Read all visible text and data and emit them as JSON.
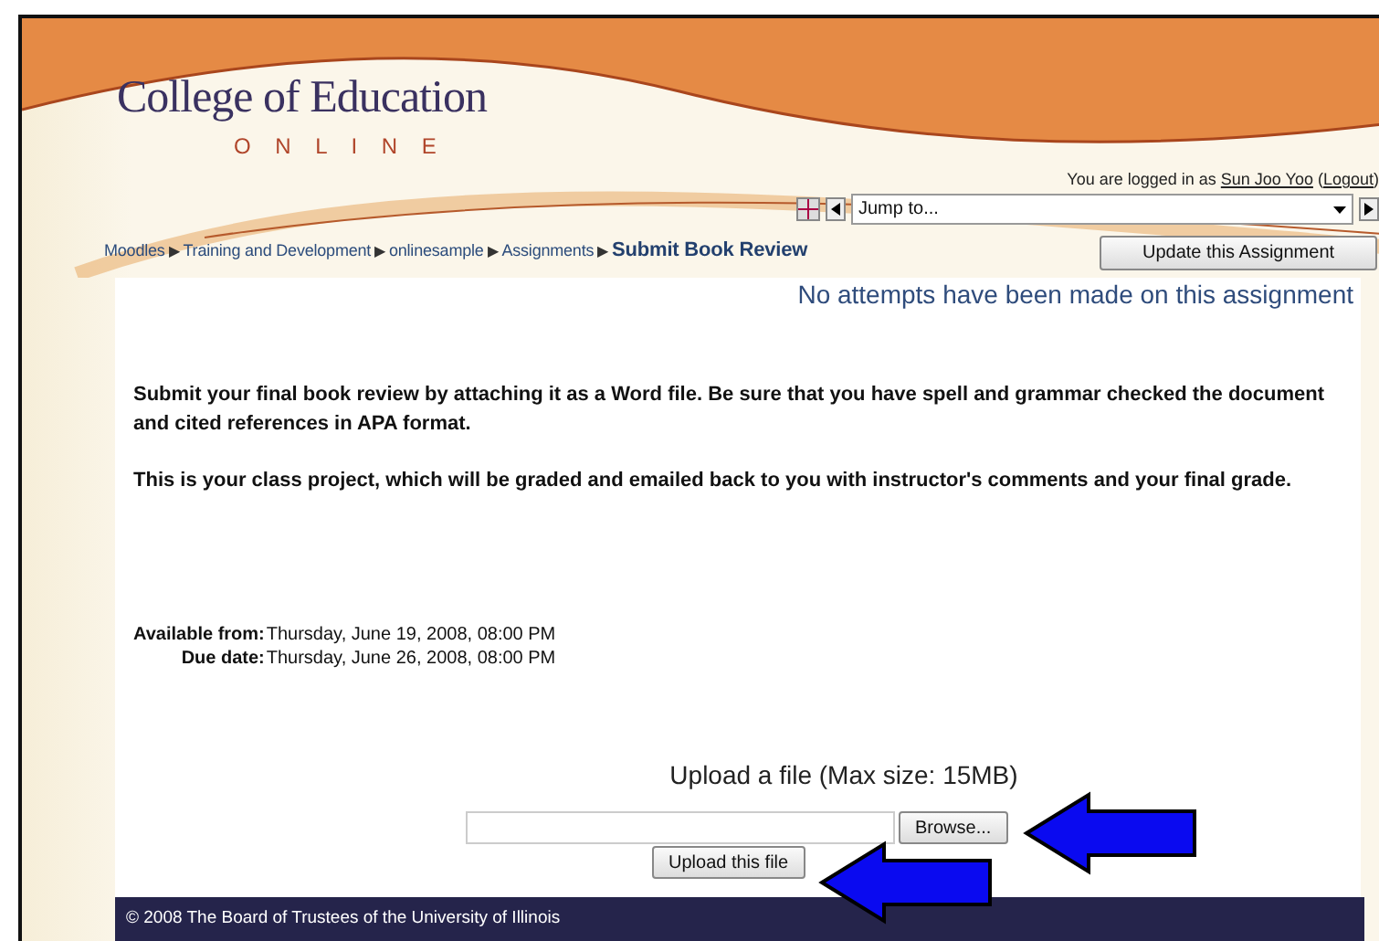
{
  "header": {
    "title": "College of Education",
    "subtitle": "O N L I N E",
    "login": [
      {
        "kind": "text",
        "text": "You are logged in as "
      },
      {
        "kind": "link",
        "text": "Sun Joo Yoo"
      },
      {
        "kind": "text",
        "text": " ("
      },
      {
        "kind": "link",
        "text": "Logout"
      },
      {
        "kind": "text",
        "text": ")"
      }
    ],
    "jump_to": {
      "value": "Jump to..."
    }
  },
  "breadcrumbs": [
    {
      "label": "Moodles",
      "separator": "▶",
      "current": false
    },
    {
      "label": "Training and Development",
      "separator": "▶",
      "current": false
    },
    {
      "label": "onlinesample",
      "separator": "▶",
      "current": false
    },
    {
      "label": "Assignments",
      "separator": "▶",
      "current": false
    },
    {
      "label": "Submit Book Review",
      "current": true
    }
  ],
  "update_button": "Update this Assignment",
  "status": "No attempts have been made on this assignment",
  "instructions": [
    "Submit your final book review by attaching it as a Word file. Be sure that you have spell and grammar checked the document and cited references in APA format.",
    "This is your class project, which will be graded and emailed back to you with instructor's comments and your final grade."
  ],
  "dates": [
    {
      "label": "Available from:",
      "value": "Thursday, June 19, 2008, 08:00 PM"
    },
    {
      "label": "Due date:",
      "value": "Thursday, June 26, 2008, 08:00 PM"
    }
  ],
  "upload": {
    "title": "Upload a file (Max size: 15MB)",
    "browse": "Browse...",
    "submit": "Upload this file"
  },
  "footer": "© 2008 The Board of Trustees of the University of Illinois"
}
